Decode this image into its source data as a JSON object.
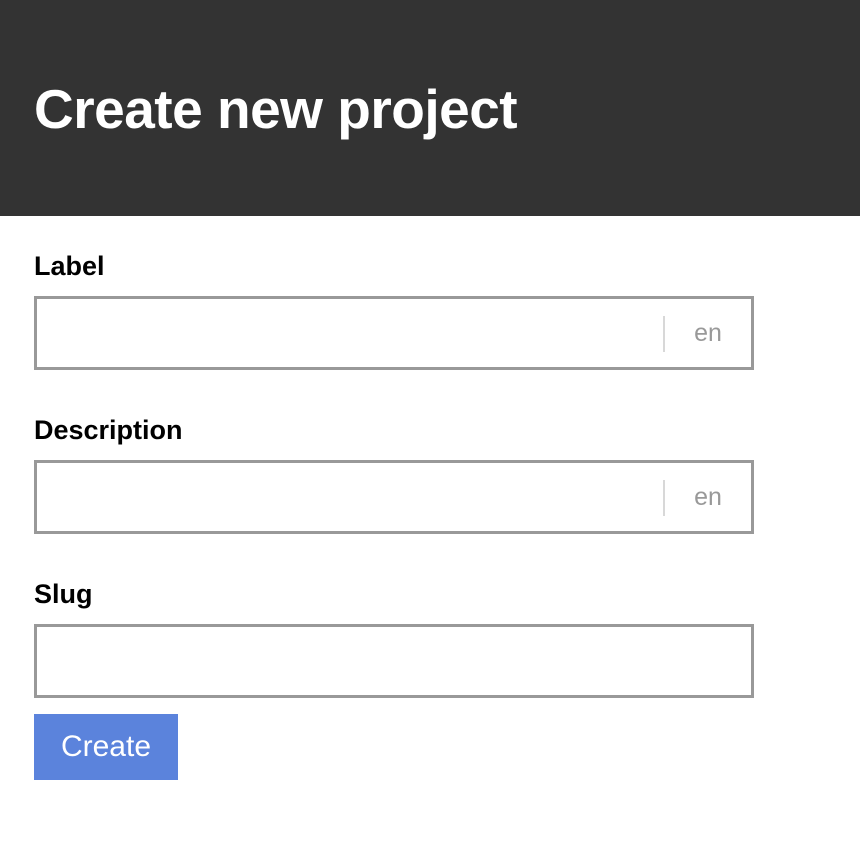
{
  "header": {
    "title": "Create new project"
  },
  "form": {
    "label_field": {
      "label": "Label",
      "value": "",
      "placeholder": "",
      "language": "en"
    },
    "description_field": {
      "label": "Description",
      "value": "",
      "placeholder": "",
      "language": "en"
    },
    "slug_field": {
      "label": "Slug",
      "value": "",
      "placeholder": ""
    },
    "submit_label": "Create"
  },
  "colors": {
    "header_bg": "#333333",
    "button_bg": "#5b83dc",
    "input_border": "#999999",
    "lang_text": "#999999"
  }
}
